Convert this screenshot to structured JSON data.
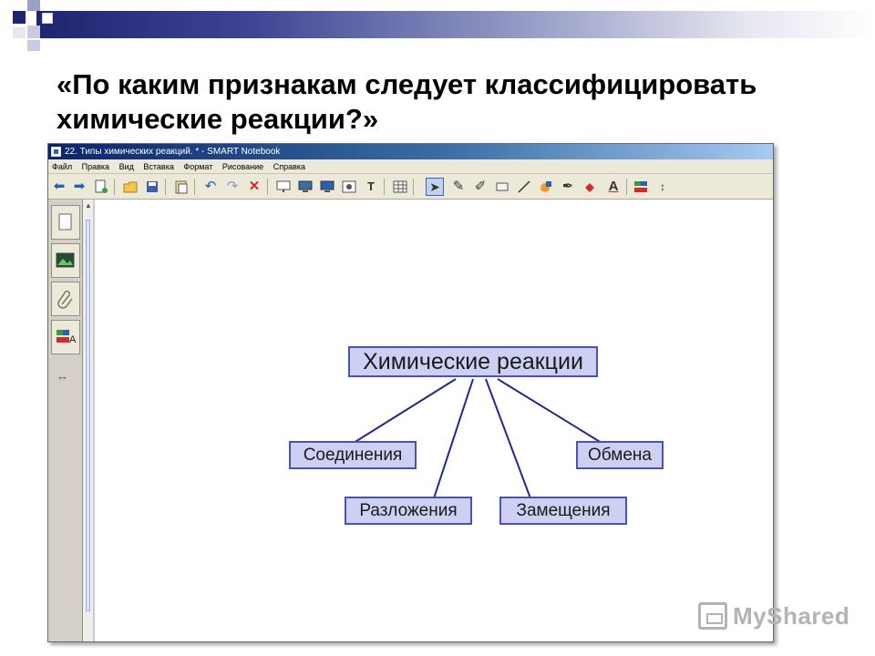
{
  "slide": {
    "title_line1": "«По каким признакам следует классифицировать",
    "title_line2": "химические реакции?»",
    "watermark": "MyShared"
  },
  "window": {
    "title": "22. Типы химических реакций. * - SMART Notebook",
    "menu": [
      "Файл",
      "Правка",
      "Вид",
      "Вставка",
      "Формат",
      "Рисование",
      "Справка"
    ]
  },
  "toolbar": {
    "icons": [
      "back-arrow-icon",
      "forward-arrow-icon",
      "add-page-icon",
      "open-folder-icon",
      "save-disk-icon",
      "paste-icon",
      "undo-icon",
      "redo-icon",
      "delete-x-icon",
      "screen-shade-icon",
      "display-icon",
      "full-screen-icon",
      "capture-icon",
      "text-tool-icon",
      "table-icon",
      "select-arrow-icon",
      "pen-icon",
      "creative-pen-icon",
      "eraser-icon",
      "line-icon",
      "shape-icon",
      "magic-pen-icon",
      "fill-icon",
      "font-icon",
      "properties-icon",
      "move-toolbar-icon"
    ]
  },
  "sidebar": {
    "tabs": [
      "page-sorter-icon",
      "gallery-icon",
      "attachments-icon",
      "properties-icon"
    ]
  },
  "concept_map": {
    "root": "Химические реакции",
    "branches": [
      "Соединения",
      "Разложения",
      "Замещения",
      "Обмена"
    ]
  },
  "colors": {
    "box_fill": "#cdd0f3",
    "box_border": "#4a52b3",
    "link": "#1f2a8a",
    "titlebar": "#0a246a"
  }
}
